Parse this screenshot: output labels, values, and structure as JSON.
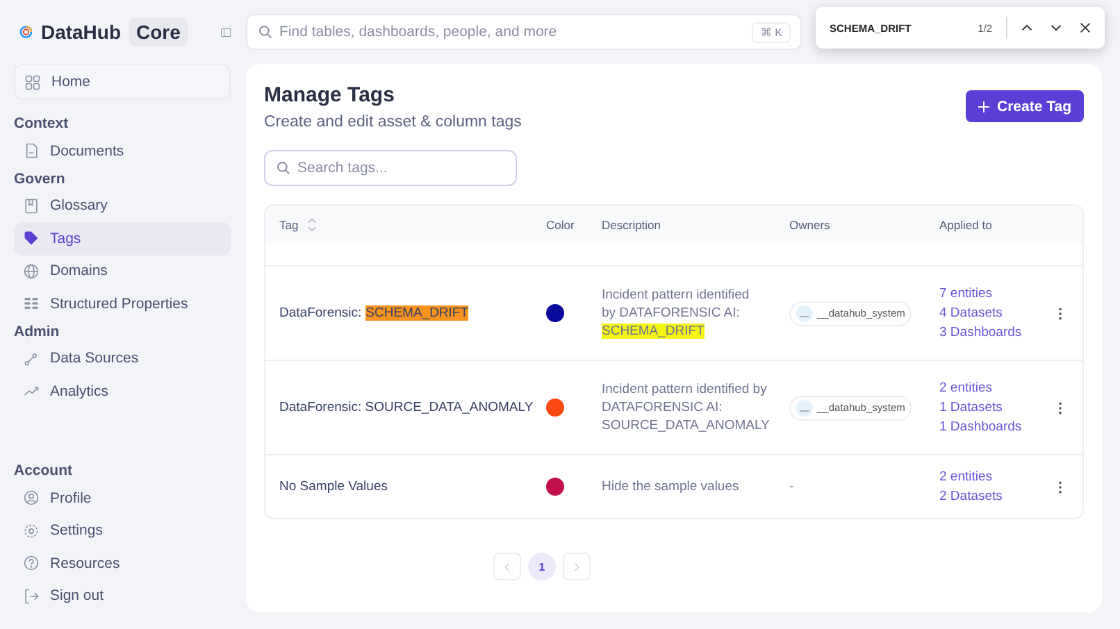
{
  "brand": {
    "name": "DataHub",
    "edition": "Core"
  },
  "search": {
    "placeholder": "Find tables, dashboards, people, and more",
    "shortcut": "⌘ K"
  },
  "find_bar": {
    "query": "SCHEMA_DRIFT",
    "count": "1/2"
  },
  "sidebar": {
    "items": [
      {
        "kind": "item",
        "label": "Home",
        "selected": false
      },
      {
        "kind": "heading",
        "label": "Context"
      },
      {
        "kind": "item",
        "label": "Documents",
        "selected": false
      },
      {
        "kind": "heading",
        "label": "Govern"
      },
      {
        "kind": "item",
        "label": "Glossary",
        "selected": false
      },
      {
        "kind": "item",
        "label": "Tags",
        "selected": true
      },
      {
        "kind": "item",
        "label": "Domains",
        "selected": false
      },
      {
        "kind": "item",
        "label": "Structured Properties",
        "selected": false
      },
      {
        "kind": "heading",
        "label": "Admin"
      },
      {
        "kind": "item",
        "label": "Data Sources",
        "selected": false
      },
      {
        "kind": "item",
        "label": "Analytics",
        "selected": false
      }
    ],
    "account": [
      {
        "kind": "heading",
        "label": "Account"
      },
      {
        "kind": "item",
        "label": "Profile",
        "selected": false
      },
      {
        "kind": "item",
        "label": "Settings",
        "selected": false
      },
      {
        "kind": "item",
        "label": "Resources",
        "selected": false
      },
      {
        "kind": "item",
        "label": "Sign out",
        "selected": false
      }
    ]
  },
  "page": {
    "title": "Manage Tags",
    "subtitle": "Create and edit asset & column tags",
    "create_button": "Create Tag",
    "search_placeholder": "Search tags..."
  },
  "table": {
    "columns": [
      "Tag",
      "Color",
      "Description",
      "Owners",
      "Applied to"
    ],
    "rows": [
      {
        "name": [
          {
            "text": "DataForensic:",
            "highlighted": false
          },
          {
            "text": "SCHEMA_DRIFT",
            "highlighted": true,
            "current": true
          }
        ],
        "color": "#0a0a9c",
        "description": [
          {
            "text": "Incident pattern identified by DATAFORENSIC AI:",
            "highlighted": false
          },
          {
            "text": "SCHEMA_DRIFT",
            "highlighted": true,
            "current": false
          }
        ],
        "owner": {
          "avatar": "__",
          "name": "__datahub_system"
        },
        "applied": [
          "7 entities",
          "4 Datasets",
          "3 Dashboards"
        ]
      },
      {
        "name": [
          {
            "text": "DataForensic: SOURCE_DATA_ANOMALY",
            "highlighted": false
          }
        ],
        "color": "#fc4a14",
        "description": [
          {
            "text": "Incident pattern identified by DATAFORENSIC AI: SOURCE_DATA_ANOMALY",
            "highlighted": false
          }
        ],
        "owner": {
          "avatar": "__",
          "name": "__datahub_system"
        },
        "applied": [
          "2 entities",
          "1 Datasets",
          "1 Dashboards"
        ]
      },
      {
        "name": [
          {
            "text": "No Sample Values",
            "highlighted": false
          }
        ],
        "color": "#c2104a",
        "description": [
          {
            "text": "Hide the sample values",
            "highlighted": false
          }
        ],
        "owner_empty": "-",
        "applied": [
          "2 entities",
          "2 Datasets"
        ]
      }
    ]
  },
  "pagination": {
    "pages": [
      {
        "label": "1",
        "selected": true
      }
    ]
  }
}
